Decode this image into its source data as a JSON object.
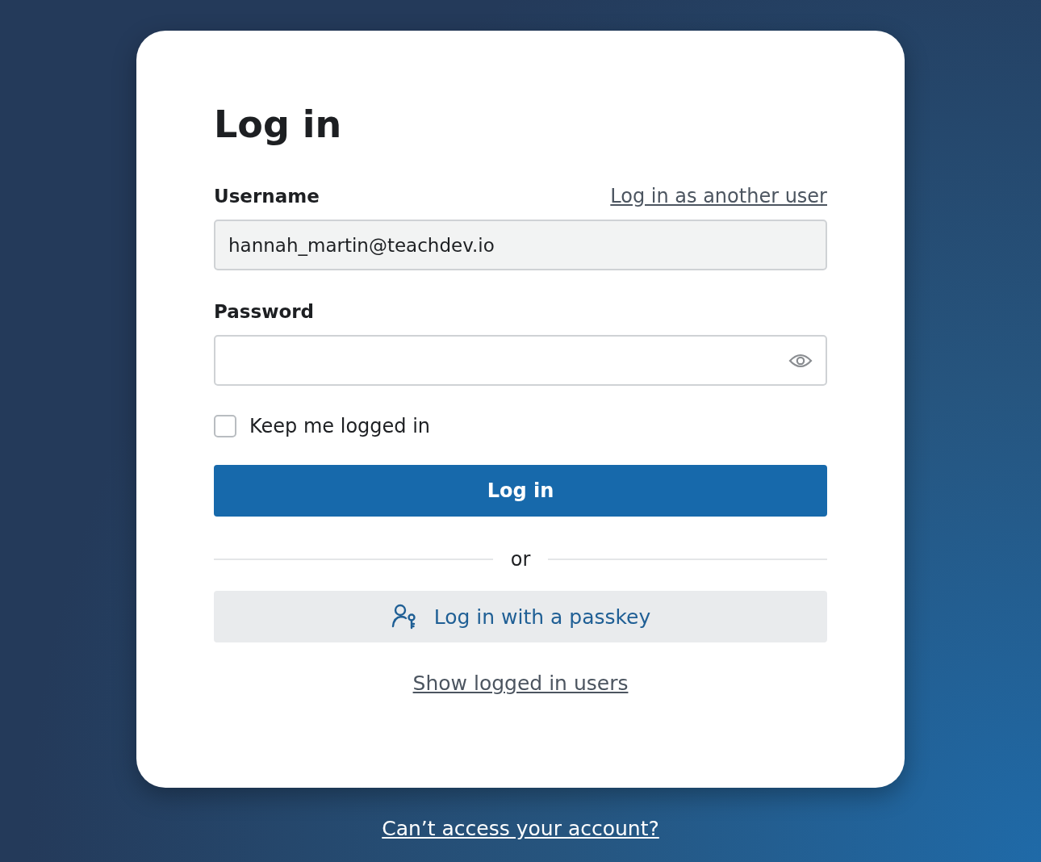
{
  "title": "Log in",
  "username": {
    "label": "Username",
    "link": "Log in as another user",
    "value": "hannah_martin@teachdev.io"
  },
  "password": {
    "label": "Password"
  },
  "keep_logged_in": {
    "label": "Keep me logged in",
    "checked": false
  },
  "login_button": "Log in",
  "separator": "or",
  "passkey_button": "Log in with a passkey",
  "show_users_link": "Show logged in users",
  "footer_link": "Can’t access your account?"
}
